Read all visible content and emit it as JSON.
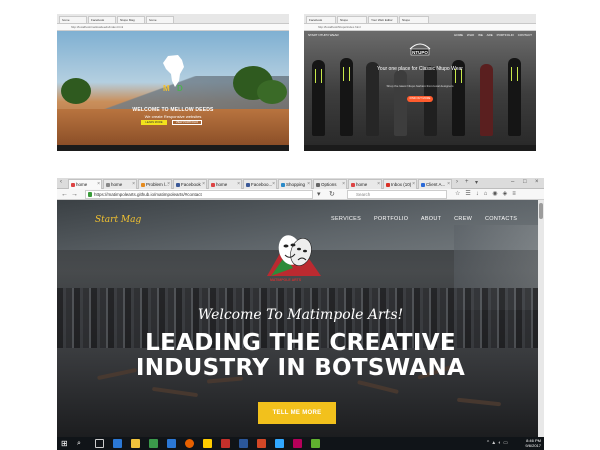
{
  "shot1": {
    "tabs": [
      "home",
      "Facebook",
      "Ntupo Mag",
      "home"
    ],
    "url": "http://localhost/mellowdeeds/index.html",
    "logo_letters": "M D",
    "title": "WELCOME TO MELLOW DEEDS",
    "subtitle": "We create Responsive websites",
    "btn1": "LEARN MORE",
    "btn2": "VIEW PORTFOLIO"
  },
  "shot2": {
    "tabs": [
      "Facebook",
      "Ntupo",
      "Your Web Editor",
      "Ntupo"
    ],
    "url": "http://localhost/Ntupo/index.html",
    "brand": "START NTUPO WEAR",
    "nav": [
      "HOME",
      "WHO WE ARE",
      "PORTFOLIO",
      "CONTACT"
    ],
    "logo_text": "NTUPO",
    "title": "Your one place for Classic Ntupo Wear",
    "subtitle": "Shop the latest Ntupo fashion from local designers",
    "button": "FIND OUT MORE"
  },
  "browser": {
    "tabs": [
      {
        "label": "home",
        "active": true
      },
      {
        "label": "home",
        "active": false
      },
      {
        "label": "Problem l...",
        "active": false
      },
      {
        "label": "Facebook",
        "active": false
      },
      {
        "label": "home",
        "active": false
      },
      {
        "label": "Faceboo...",
        "active": false
      },
      {
        "label": "Shopping",
        "active": false
      },
      {
        "label": "Options",
        "active": false
      },
      {
        "label": "home",
        "active": false
      },
      {
        "label": "Inbox (10)",
        "active": false
      },
      {
        "label": "Client A...",
        "active": false
      }
    ],
    "url": "https://matimpolearts.github.io/matimpolearts/#contact",
    "search_placeholder": "Search"
  },
  "site": {
    "brand": "Start Mag",
    "nav": [
      "SERVICES",
      "PORTFOLIO",
      "ABOUT",
      "CREW",
      "CONTACTS"
    ],
    "logo_text": "MATIMPOLE ARTS",
    "welcome": "Welcome To Matimpole Arts!",
    "headline_line1": "LEADING THE CREATIVE",
    "headline_line2": "INDUSTRY IN BOTSWANA",
    "cta": "TELL ME MORE"
  },
  "taskbar": {
    "time": "8:46 PM",
    "date": "9/6/2017"
  },
  "colors": {
    "accent": "#f2c11c",
    "brand_text": "#f2c230",
    "taskbar": "#101418"
  }
}
